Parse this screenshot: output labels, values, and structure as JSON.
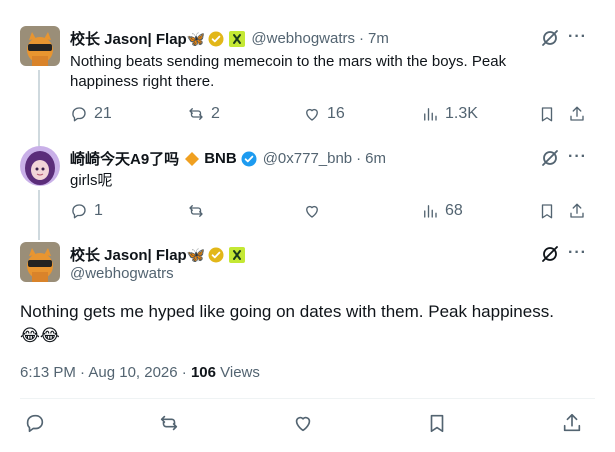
{
  "tweet1": {
    "name": "校长 Jason| Flap🦋",
    "handle": "@webhogwatrs",
    "separator": "·",
    "time": "7m",
    "text": "Nothing beats sending memecoin to the mars with the boys. Peak happiness right there.",
    "stats": {
      "replies": "21",
      "reposts": "2",
      "likes": "16",
      "views": "1.3K"
    }
  },
  "tweet2": {
    "name": "崎崎今天A9了吗",
    "brand": "BNB",
    "handle": "@0x777_bnb",
    "separator": "·",
    "time": "6m",
    "text": "girls呢",
    "stats": {
      "replies": "1",
      "reposts": "",
      "likes": "",
      "views": "68"
    }
  },
  "main": {
    "name": "校长 Jason| Flap🦋",
    "handle": "@webhogwatrs",
    "text": "Nothing gets me hyped like going on dates with them. Peak happiness.",
    "emoji": "😂😂",
    "timestamp": "6:13 PM · Aug 10, 2026 · ",
    "views_count": "106",
    "views_label": " Views"
  },
  "icons": {
    "more": "more-icon",
    "grok": "grok-icon",
    "verified_gold": "verified-gold-icon",
    "verified_blue": "verified-blue-icon",
    "affiliate": "affiliate-badge-icon",
    "brand_diamond": "bnb-diamond-icon"
  },
  "colors": {
    "verified_blue": "#1d9bf0",
    "verified_gold": "#e2b719",
    "affiliate_green": "#c4e834",
    "bnb_orange": "#f0a020",
    "muted": "#536471",
    "line": "#cfd9de"
  }
}
